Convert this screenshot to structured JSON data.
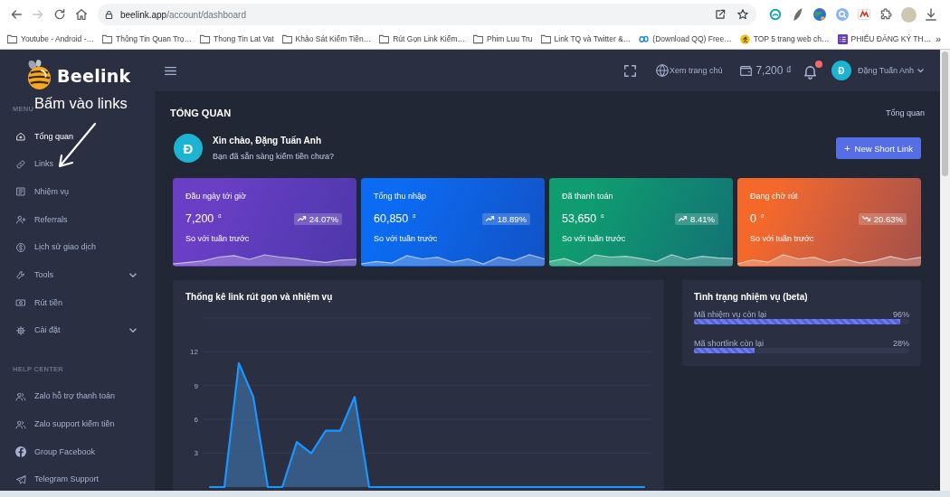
{
  "browser": {
    "nav_buttons": [
      {
        "kind": "back",
        "disabled": false
      },
      {
        "kind": "forward",
        "disabled": true
      },
      {
        "kind": "reload",
        "disabled": false
      },
      {
        "kind": "home",
        "disabled": false
      }
    ],
    "address": {
      "host": "beelink.app",
      "path": "/account/dashboard"
    },
    "bookmarks": [
      {
        "kind": "folder",
        "label": "Youtube - Android -…"
      },
      {
        "kind": "folder",
        "label": "Thông Tin Quan Trọ…"
      },
      {
        "kind": "folder",
        "label": "Thong Tin Lat Vat"
      },
      {
        "kind": "folder",
        "label": "Khảo Sát Kiếm Tiền…"
      },
      {
        "kind": "folder",
        "label": "Rút Gọn Link Kiếm…"
      },
      {
        "kind": "folder",
        "label": "Phim Luu Tru"
      },
      {
        "kind": "folder",
        "label": "Link TQ và Twitter &…"
      },
      {
        "kind": "qq",
        "label": "(Download QQ) Free…"
      },
      {
        "kind": "runner",
        "label": "TOP 5 trang web ch…"
      },
      {
        "kind": "form",
        "label": "PHIẾU ĐĂNG KÝ TH…"
      }
    ],
    "bookmarks_more": "»"
  },
  "sidebar": {
    "brand": "Beelink",
    "sections": [
      {
        "title": "MENU",
        "items": [
          {
            "kind": "home",
            "label": "Tổng quan",
            "selected": true,
            "has_submenu": false
          },
          {
            "kind": "link",
            "label": "Links",
            "selected": false,
            "has_submenu": false
          },
          {
            "kind": "tasks",
            "label": "Nhiệm vụ",
            "selected": false,
            "has_submenu": false
          },
          {
            "kind": "referral",
            "label": "Referrals",
            "selected": false,
            "has_submenu": false
          },
          {
            "kind": "money",
            "label": "Lịch sử giao dịch",
            "selected": false,
            "has_submenu": false
          },
          {
            "kind": "tools",
            "label": "Tools",
            "selected": false,
            "has_submenu": true
          },
          {
            "kind": "withdraw",
            "label": "Rút tiền",
            "selected": false,
            "has_submenu": false
          },
          {
            "kind": "settings",
            "label": "Cài đặt",
            "selected": false,
            "has_submenu": true
          }
        ]
      },
      {
        "title": "HELP CENTER",
        "items": [
          {
            "kind": "people",
            "label": "Zalo hỗ trợ thanh toán",
            "selected": false,
            "has_submenu": false
          },
          {
            "kind": "people",
            "label": "Zalo support kiếm tiền",
            "selected": false,
            "has_submenu": false
          },
          {
            "kind": "facebook",
            "label": "Group Facebook",
            "selected": false,
            "has_submenu": false
          },
          {
            "kind": "telegram",
            "label": "Telegram Support",
            "selected": false,
            "has_submenu": false
          }
        ]
      }
    ]
  },
  "annotation": {
    "text": "Bấm vào links"
  },
  "header": {
    "home_link": "Xem trang chủ",
    "balance": "7,200 ₫",
    "notification": true,
    "user": {
      "initial": "Đ",
      "name": "Đặng Tuấn Anh"
    }
  },
  "page": {
    "title": "TỔNG QUAN",
    "breadcrumb": "Tổng quan"
  },
  "welcome": {
    "initial": "Đ",
    "greeting": "Xin chào, Đặng Tuấn Anh",
    "subtitle": "Bạn đã sẵn sàng kiếm tiền chưa?",
    "button": {
      "icon": "+",
      "label": "New Short Link"
    }
  },
  "stats": [
    {
      "title": "Đầu ngày tới giờ",
      "value": "7,200 $^{₫}$",
      "change": "24.07%",
      "rising": true,
      "note": "So với tuần trước",
      "color": "#6a3fc6"
    },
    {
      "title": "Tổng thu nhập",
      "value": "60,850 $^{₫}$",
      "change": "18.89%",
      "rising": true,
      "note": "So với tuần trước",
      "color": "#0b6bf2"
    },
    {
      "title": "Đã thanh toán",
      "value": "53,650 $^{₫}$",
      "change": "8.41%",
      "rising": true,
      "note": "So với tuần trước",
      "color": "#0f9d6f"
    },
    {
      "title": "Đang chờ rút",
      "value": "0 $^{₫}$",
      "change": "20.63%",
      "rising": false,
      "note": "So với tuần trước",
      "color": "#f4682a"
    }
  ],
  "chart": {
    "title": "Thống kê link rút gọn và nhiệm vụ",
    "chart_data": {
      "type": "area",
      "values": [
        0,
        0,
        11,
        8,
        0,
        0,
        4,
        3,
        5,
        5,
        8,
        0,
        0,
        0,
        0,
        0,
        0,
        0,
        0,
        0,
        0,
        0,
        0,
        0,
        0,
        0,
        0,
        0,
        0,
        0,
        0
      ],
      "ylim": [
        0,
        15
      ],
      "yticks": [
        3,
        6,
        9,
        12
      ],
      "grid": true
    }
  },
  "task_status": {
    "title": "Tình trạng nhiệm vụ (beta)",
    "items": [
      {
        "label": "Mã nhiệm vụ còn lại",
        "reading": "96%",
        "level": 0.96
      },
      {
        "label": "Mã shortlink còn lại",
        "reading": "28%",
        "level": 0.28
      }
    ]
  }
}
